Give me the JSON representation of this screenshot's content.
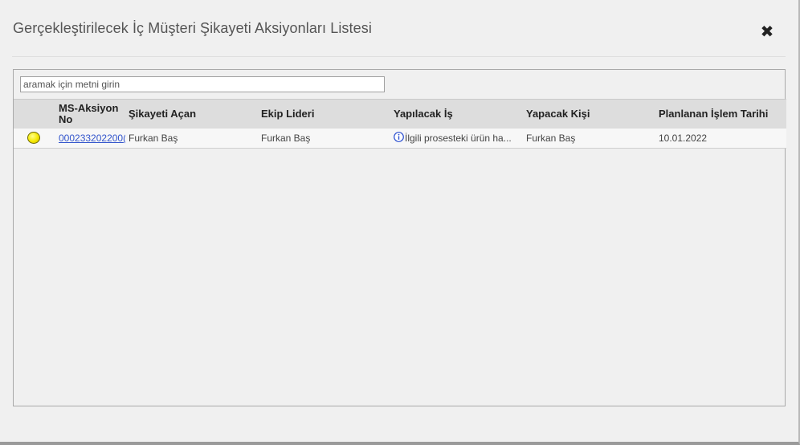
{
  "dialog": {
    "title": "Gerçekleştirilecek İç Müşteri Şikayeti Aksiyonları Listesi",
    "close_icon": "close-icon",
    "close_glyph": "✖"
  },
  "search": {
    "placeholder": "aramak için metni girin",
    "value": ""
  },
  "table": {
    "columns": [
      "MS-Aksiyon No",
      "Şikayeti Açan",
      "Ekip Lideri",
      "Yapılacak İş",
      "Yapacak Kişi",
      "Planlanan İşlem Tarihi"
    ],
    "rows": [
      {
        "status_color": "#f5e800",
        "ms_aksiyon_no": "000233202200(",
        "sikayeti_acan": "Furkan Baş",
        "ekip_lideri": "Furkan Baş",
        "yapilacak_is": "İlgili prosesteki ürün ha...",
        "yapacak_kisi": "Furkan Baş",
        "planlanan_tarih": "10.01.2022"
      }
    ]
  },
  "colors": {
    "link": "#3355cc",
    "header_bg": "#dddddd",
    "status_yellow": "#f5e800",
    "info_icon": "#2b4fd0"
  }
}
